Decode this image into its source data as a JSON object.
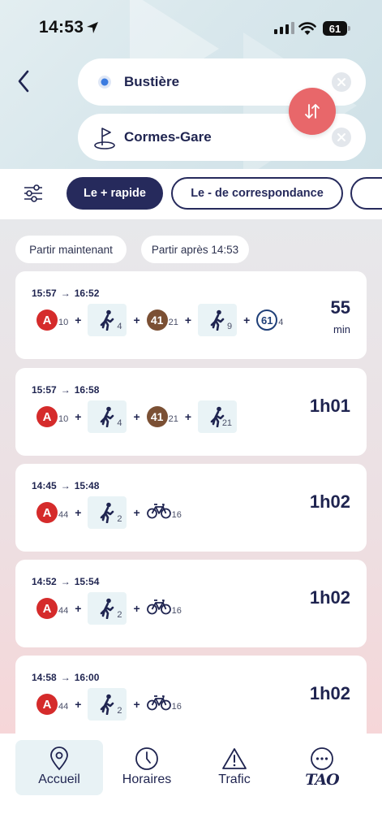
{
  "status_bar": {
    "time": "14:53",
    "battery": "61"
  },
  "search": {
    "from": "Bustière",
    "to": "Cormes-Gare"
  },
  "filters": {
    "active": "Le + rapide",
    "second": "Le - de correspondance"
  },
  "time_options": {
    "now": "Partir maintenant",
    "after": "Partir après 14:53"
  },
  "results": [
    {
      "depart": "15:57",
      "arrive": "16:52",
      "duration": "55",
      "duration_unit": "min",
      "legs": [
        {
          "type": "metro",
          "line": "A",
          "minutes": "10"
        },
        {
          "type": "walk",
          "minutes": "4"
        },
        {
          "type": "bus",
          "line": "41",
          "minutes": "21"
        },
        {
          "type": "walk",
          "minutes": "9"
        },
        {
          "type": "bus",
          "line": "61",
          "minutes": "4"
        }
      ]
    },
    {
      "depart": "15:57",
      "arrive": "16:58",
      "duration": "1h01",
      "legs": [
        {
          "type": "metro",
          "line": "A",
          "minutes": "10"
        },
        {
          "type": "walk",
          "minutes": "4"
        },
        {
          "type": "bus",
          "line": "41",
          "minutes": "21"
        },
        {
          "type": "walk",
          "minutes": "21"
        }
      ]
    },
    {
      "depart": "14:45",
      "arrive": "15:48",
      "duration": "1h02",
      "legs": [
        {
          "type": "metro",
          "line": "A",
          "minutes": "44"
        },
        {
          "type": "walk",
          "minutes": "2"
        },
        {
          "type": "bike",
          "minutes": "16"
        }
      ]
    },
    {
      "depart": "14:52",
      "arrive": "15:54",
      "duration": "1h02",
      "legs": [
        {
          "type": "metro",
          "line": "A",
          "minutes": "44"
        },
        {
          "type": "walk",
          "minutes": "2"
        },
        {
          "type": "bike",
          "minutes": "16"
        }
      ]
    },
    {
      "depart": "14:58",
      "arrive": "16:00",
      "duration": "1h02",
      "legs": [
        {
          "type": "metro",
          "line": "A",
          "minutes": "44"
        },
        {
          "type": "walk",
          "minutes": "2"
        },
        {
          "type": "bike",
          "minutes": "16"
        }
      ]
    }
  ],
  "nav": {
    "home": "Accueil",
    "schedules": "Horaires",
    "traffic": "Trafic",
    "brand": "TAO"
  },
  "colors": {
    "navy": "#262a5c",
    "swap": "#e8676a",
    "metro_a": "#d52b2b",
    "bus_41": "#7b5034",
    "bus_61": "#1f3f78"
  },
  "icons": {
    "plus": "+",
    "arrow": "→"
  }
}
